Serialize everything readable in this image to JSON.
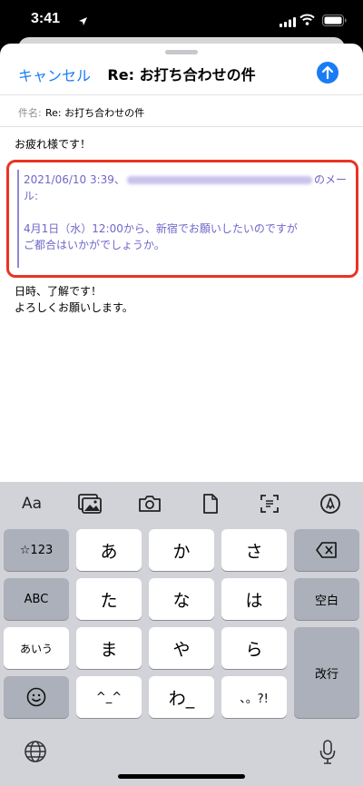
{
  "status_bar": {
    "time": "3:41"
  },
  "compose": {
    "cancel_label": "キャンセル",
    "title": "Re: お打ち合わせの件",
    "subject_label": "件名:",
    "subject_value": "Re: お打ち合わせの件",
    "greeting": "お疲れ様です！",
    "quote": {
      "header_prefix": "2021/06/10 3:39、",
      "header_suffix": "のメー",
      "header_wrap": "ル:",
      "line1": "4月1日（水）12:00から、新宿でお願いしたいのですが",
      "line2": "ご都合はいかがでしょうか。"
    },
    "reply_line1": "日時、了解です！",
    "reply_line2": "よろしくお願いします。"
  },
  "keyboard": {
    "format_label": "Aa",
    "keys": {
      "num": "☆123",
      "a": "あ",
      "ka": "か",
      "sa": "さ",
      "abc": "ABC",
      "ta": "た",
      "na": "な",
      "ha": "は",
      "space": "空白",
      "aiu": "あいう",
      "ma": "ま",
      "ya": "や",
      "ra": "ら",
      "enter": "改行",
      "kaomoji": "^_^",
      "wa": "わ_",
      "punct": "、。?!"
    }
  },
  "colors": {
    "accent": "#1a7cf5",
    "quote": "#6f67c9",
    "highlight": "#ea3323",
    "keyboard_bg": "#d1d3d9"
  }
}
